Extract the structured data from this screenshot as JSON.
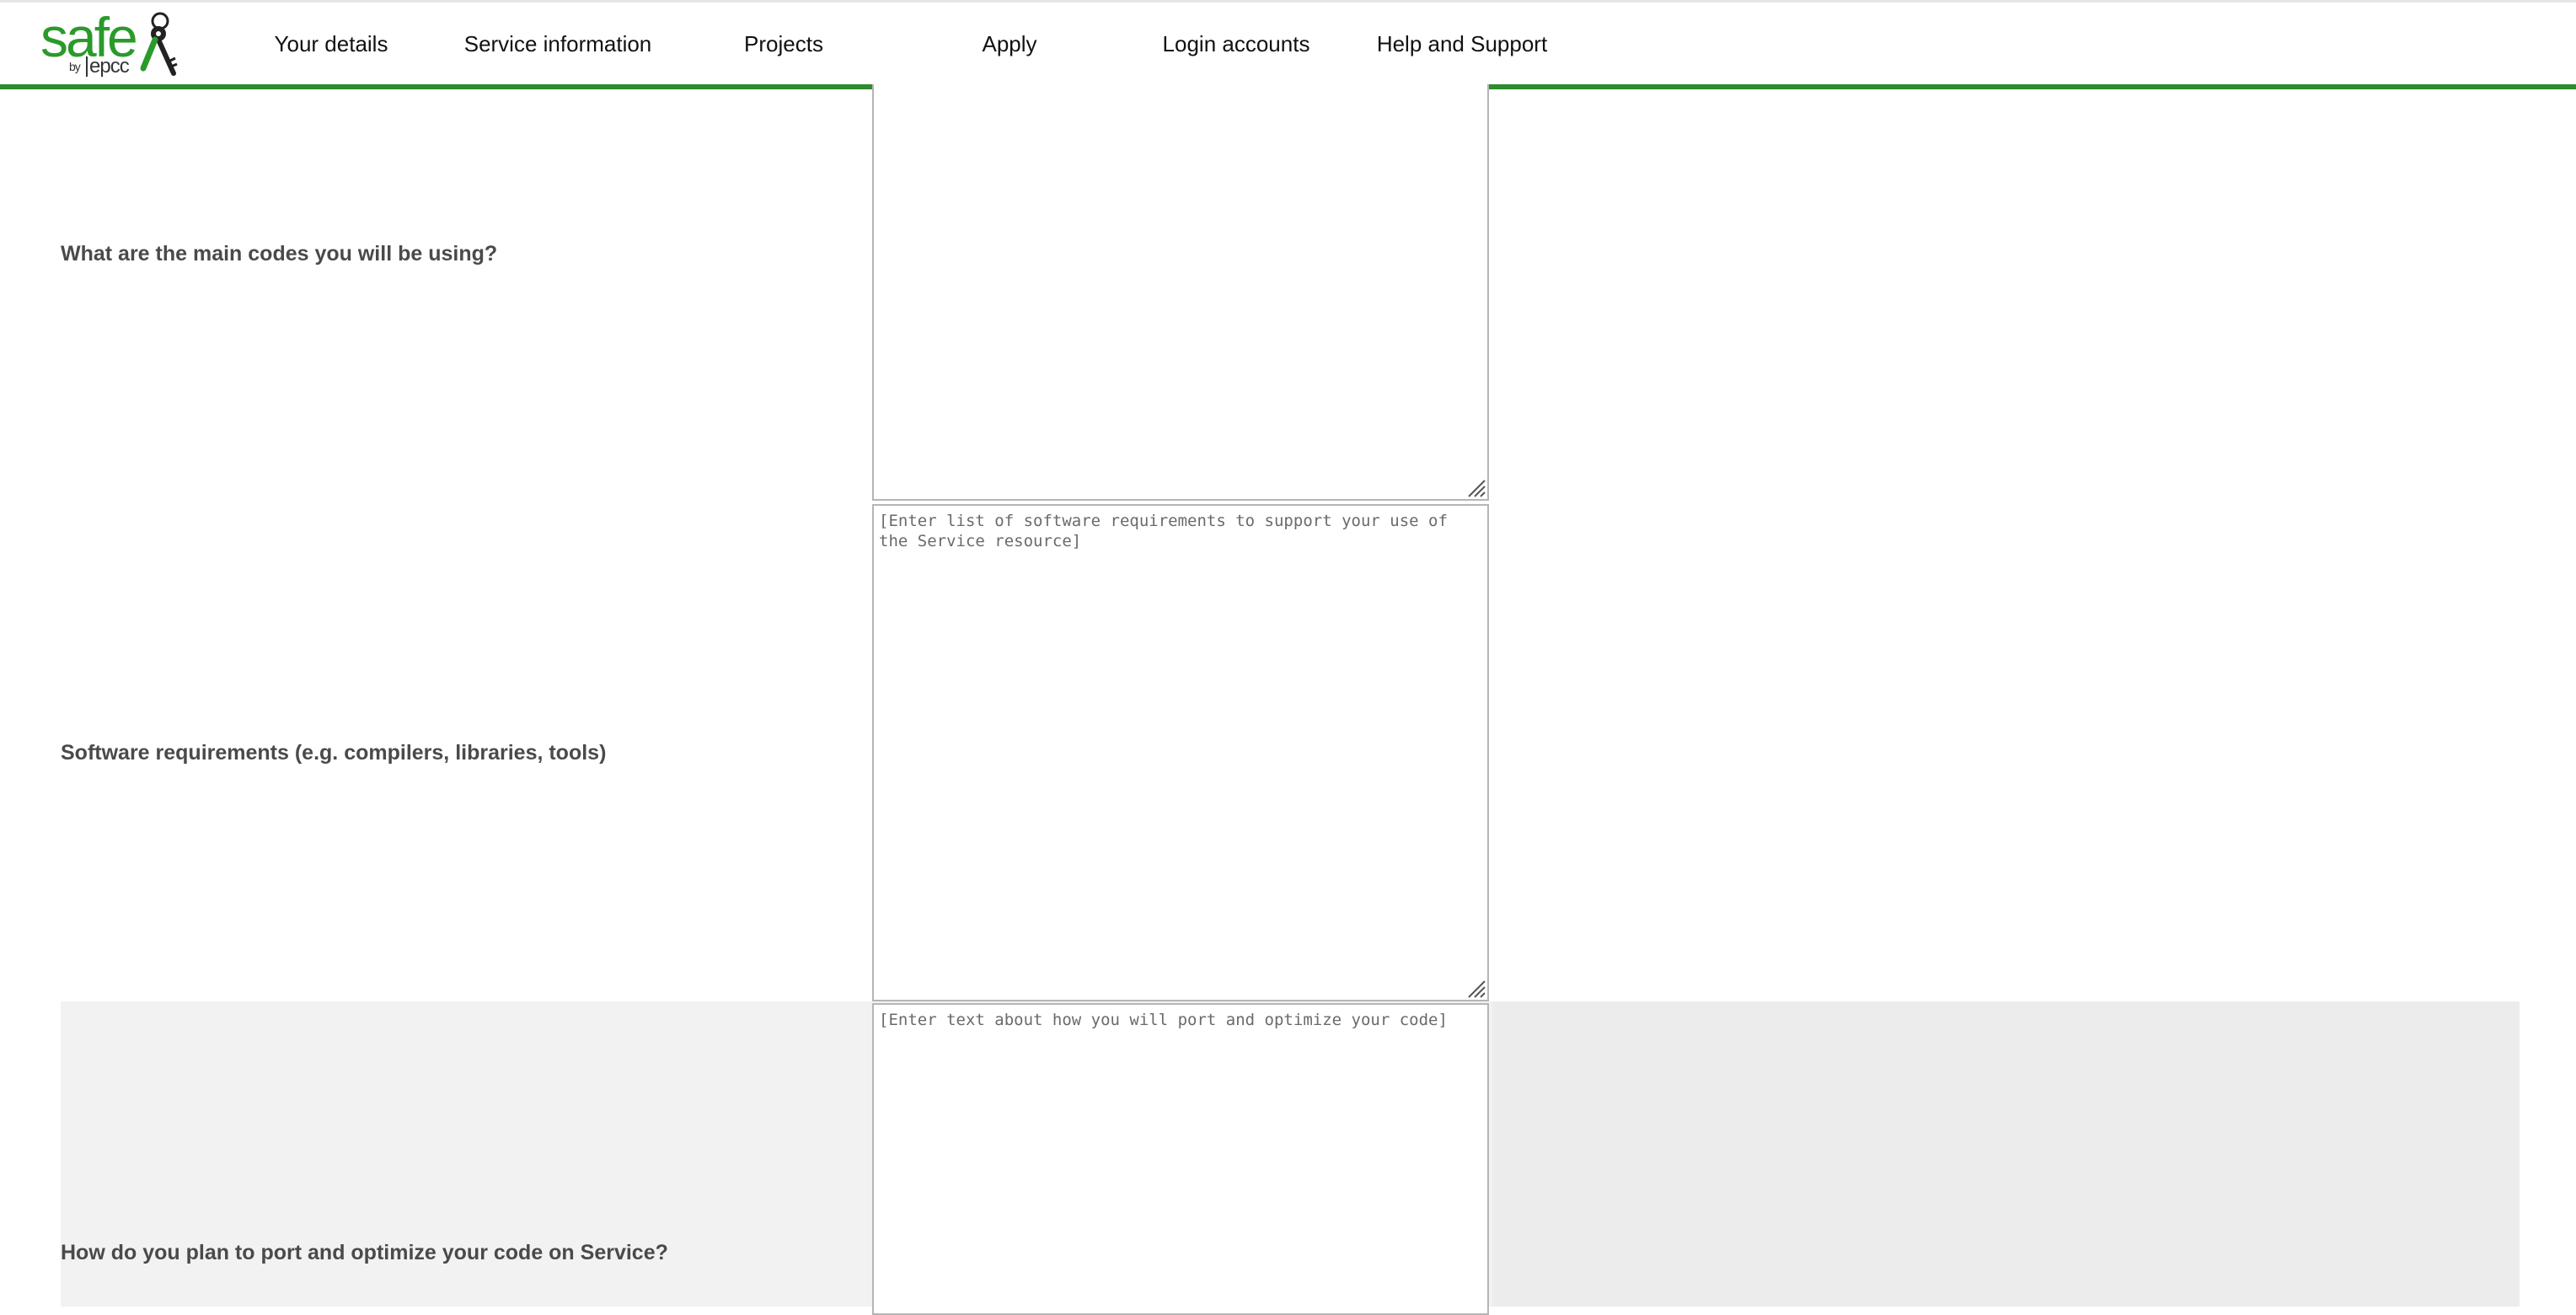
{
  "brand": {
    "logo_word": "safe",
    "logo_by": "by",
    "logo_org": "epcc"
  },
  "nav": {
    "items": [
      {
        "label": "Your details"
      },
      {
        "label": "Service information"
      },
      {
        "label": "Projects"
      },
      {
        "label": "Apply"
      },
      {
        "label": "Login accounts"
      },
      {
        "label": "Help and Support"
      }
    ]
  },
  "form": {
    "main_codes": {
      "label": "What are the main codes you will be using?",
      "value": "",
      "placeholder": ""
    },
    "software_requirements": {
      "label": "Software requirements (e.g. compilers, libraries, tools)",
      "value": "",
      "placeholder": "[Enter list of software requirements to support your use of the Service resource]"
    },
    "port_optimize": {
      "label": "How do you plan to port and optimize your code on Service?",
      "value": "",
      "placeholder": "[Enter text about how you will port and optimize your code]"
    }
  },
  "colors": {
    "brand_green": "#2a9a2a",
    "nav_underline": "#2e8b2e",
    "label_text": "#4a4a4a",
    "shaded_row": "#f2f2f2"
  },
  "icons": [
    "keys-icon",
    "resize-grip-icon"
  ]
}
